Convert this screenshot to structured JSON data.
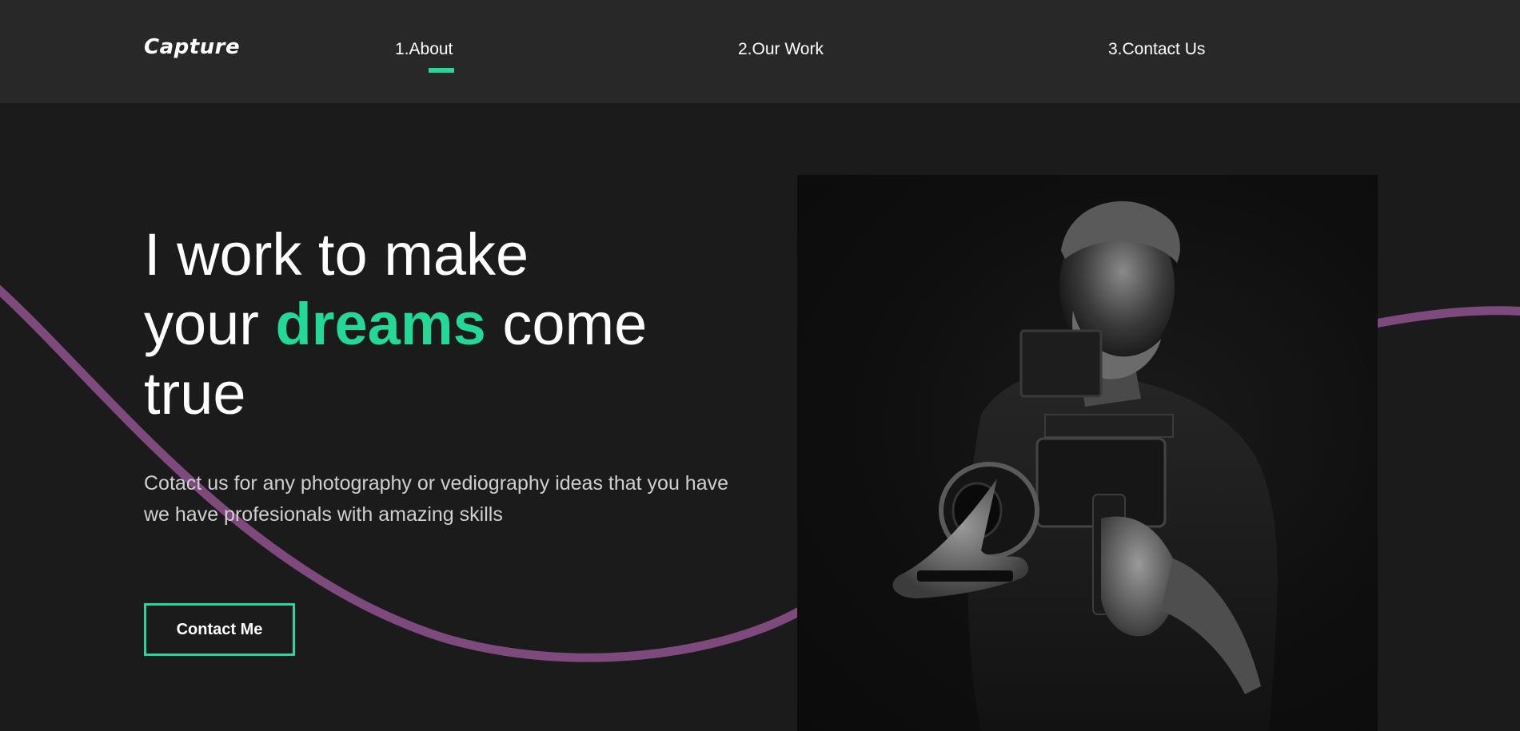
{
  "nav": {
    "logo": "Capture",
    "links": [
      {
        "label": "1.About",
        "active": true
      },
      {
        "label": "2.Our Work",
        "active": false
      },
      {
        "label": "3.Contact Us",
        "active": false
      }
    ]
  },
  "hero": {
    "title_line1": "I work to make",
    "title_line2_pre": "your ",
    "title_accent": "dreams",
    "title_line2_post": " come",
    "title_line3": "true",
    "description": "Cotact us for any photography or vediography ideas that you have we have profesionals with amazing skills",
    "button_label": "Contact Me"
  },
  "image": {
    "subject": "photographer-with-camera-rig"
  },
  "colors": {
    "background": "#1b1b1b",
    "header": "#282828",
    "accent": "#23d997",
    "wave": "#7e4a7e",
    "text": "#ffffff",
    "muted_text": "#cfcfcf"
  },
  "icons": {
    "logo": "capture-logo-wordmark"
  }
}
